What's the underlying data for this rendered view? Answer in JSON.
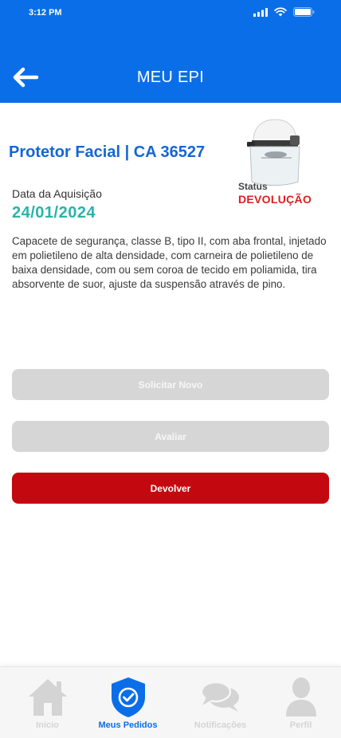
{
  "status_bar": {
    "time": "3:12 PM",
    "signal_icon": "signal-icon",
    "wifi_icon": "wifi-icon",
    "battery_icon": "battery-icon"
  },
  "header": {
    "title": "MEU EPI",
    "back_icon": "arrow-left-icon"
  },
  "product": {
    "title": "Protetor Facial | CA 36527",
    "image_icon": "face-shield-helmet",
    "status_label": "Status",
    "status_value": "DEVOLUÇÃO",
    "acquisition_label": "Data da Aquisição",
    "acquisition_date": "24/01/2024",
    "description": "Capacete de segurança, classe B, tipo II, com aba frontal, injetado em polietileno de alta densidade, com carneira de polietileno de baixa densidade, com ou sem coroa de tecido em poliamida, tira absorvente de suor, ajuste da suspensão através de pino."
  },
  "actions": {
    "request_new": "Solicitar Novo",
    "evaluate": "Avaliar",
    "return": "Devolver"
  },
  "tabs": [
    {
      "label": "Início",
      "icon": "home-icon",
      "active": false
    },
    {
      "label": "Meus Pedidos",
      "icon": "shield-check-icon",
      "active": true
    },
    {
      "label": "Notificações",
      "icon": "chat-bubbles-icon",
      "active": false
    },
    {
      "label": "Perfil",
      "icon": "user-icon",
      "active": false
    }
  ],
  "colors": {
    "header_bg": "#0a6ee8",
    "title_blue": "#1366d6",
    "date_teal": "#2bb3a8",
    "status_red": "#e01e1e",
    "return_button": "#c4080f",
    "disabled_button": "#d6d6d6",
    "inactive_tab": "#d4d4d4"
  }
}
